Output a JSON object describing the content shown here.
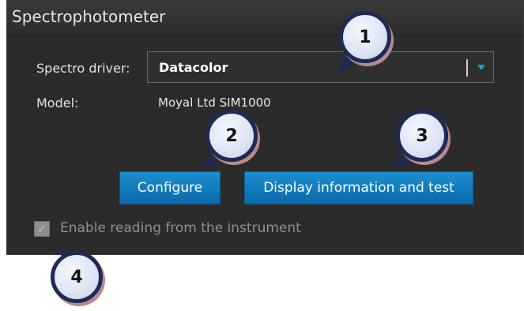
{
  "header": {
    "title": "Spectrophotometer"
  },
  "form": {
    "driver_label": "Spectro driver:",
    "driver_value": "Datacolor",
    "model_label": "Model:",
    "model_value": "Moyal Ltd SIM1000"
  },
  "buttons": {
    "configure": "Configure",
    "display": "Display information and test"
  },
  "checkbox": {
    "label": "Enable reading from the instrument",
    "checked": true,
    "mark": "✓"
  },
  "callouts": [
    "1",
    "2",
    "3",
    "4"
  ],
  "colors": {
    "panel_bg": "#2b2b2b",
    "accent": "#1aa0d8",
    "button_top": "#1d8fd0",
    "button_bottom": "#0a69aa",
    "callout_border": "#1d2a55"
  }
}
